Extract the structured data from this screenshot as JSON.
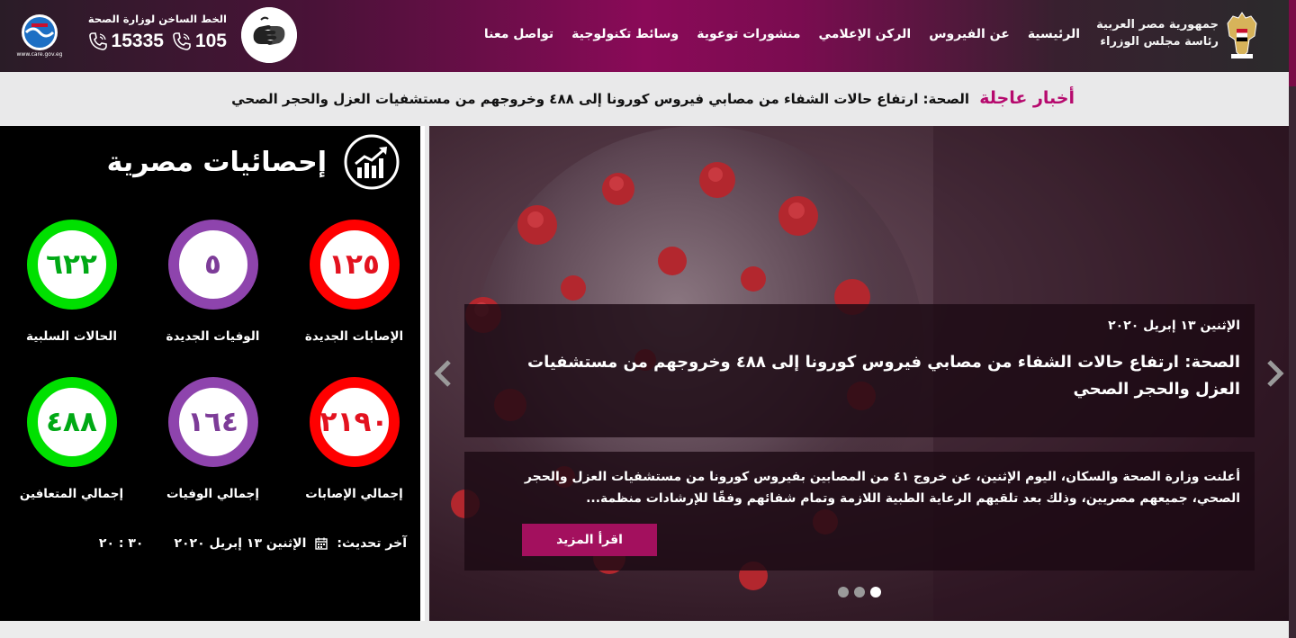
{
  "header": {
    "gov_line1": "جمهورية مصر العربية",
    "gov_line2": "رئاسة مجلس الوزراء",
    "nav": [
      {
        "label": "الرئيسية"
      },
      {
        "label": "عن الفيروس"
      },
      {
        "label": "الركن الإعلامي"
      },
      {
        "label": "منشورات توعوية"
      },
      {
        "label": "وسائط تكنولوجية"
      },
      {
        "label": "تواصل معنا"
      }
    ],
    "hotline_title": "الخط الساخن لوزارة الصحة",
    "hotline_1": "105",
    "hotline_2": "15335",
    "care_text": "www.care.gov.eg",
    "icons": {
      "emblem": "egypt-eagle-emblem",
      "sign": "sign-language-icon",
      "phone": "phone-icon",
      "care": "care-logo"
    }
  },
  "breaking": {
    "label": "أخبار عاجلة",
    "text": "الصحة: ارتفاع حالات الشفاء من مصابي فيروس كورونا إلى ٤٨٨ وخروجهم من مستشفيات العزل والحجر الصحي"
  },
  "stats": {
    "title": "إحصائيات مصرية",
    "items": [
      {
        "value": "١٢٥",
        "label": "الإصابات الجديدة",
        "color": "red"
      },
      {
        "value": "٥",
        "label": "الوفيات الجديدة",
        "color": "purple"
      },
      {
        "value": "٦٢٢",
        "label": "الحالات السلبية",
        "color": "green"
      },
      {
        "value": "٢١٩٠",
        "label": "إجمالي الإصابات",
        "color": "red"
      },
      {
        "value": "١٦٤",
        "label": "إجمالي الوفيات",
        "color": "purple"
      },
      {
        "value": "٤٨٨",
        "label": "إجمالي المتعافين",
        "color": "green"
      }
    ],
    "updated_label": "آخر تحديث:",
    "updated_date": "الإثنين ١٣ إبريل ٢٠٢٠",
    "updated_time": "٣٠ : ٢٠"
  },
  "slider": {
    "date": "الإثنين ١٣ إبريل ٢٠٢٠",
    "title": "الصحة: ارتفاع حالات الشفاء من مصابي فيروس كورونا إلى ٤٨٨ وخروجهم من مستشفيات العزل والحجر الصحي",
    "summary": "أعلنت وزارة الصحة والسكان، اليوم الإثنين، عن خروج ٤١ من المصابين بفيروس كورونا من مستشفيات العزل والحجر الصحي، جميعهم مصريين، وذلك بعد تلقيهم الرعاية الطبية اللازمة وتمام شفائهم وفقًا للإرشادات منظمة...",
    "read_more": "اقرأ المزيد",
    "dots": 3,
    "active_dot": 1
  },
  "colors": {
    "brand_magenta": "#a3105e",
    "breaking_label": "#b60a6e",
    "ring_red": "#ff0000",
    "ring_purple": "#8e44ad",
    "ring_green": "#00e000"
  }
}
